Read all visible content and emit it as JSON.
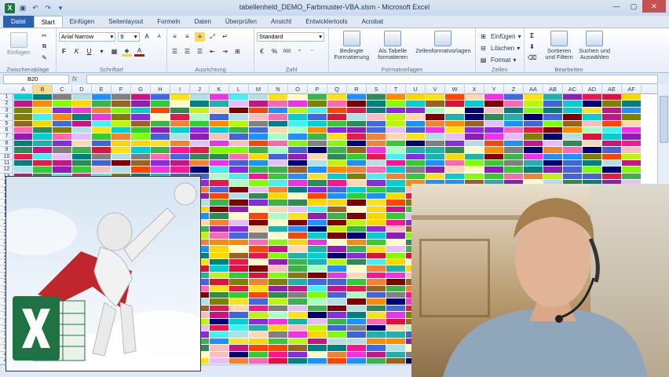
{
  "window": {
    "title": "tabellenheld_DEMO_Farbmuster-VBA.xlsm - Microsoft Excel",
    "app_icon": "excel-logo",
    "controls": [
      "minimize-icon",
      "maximize-icon",
      "close-icon"
    ]
  },
  "tabs": [
    {
      "label": "Datei"
    },
    {
      "label": "Start"
    },
    {
      "label": "Einfügen"
    },
    {
      "label": "Seitenlayout"
    },
    {
      "label": "Formeln"
    },
    {
      "label": "Daten"
    },
    {
      "label": "Überprüfen"
    },
    {
      "label": "Ansicht"
    },
    {
      "label": "Entwicklertools"
    },
    {
      "label": "Acrobat"
    }
  ],
  "ribbon": {
    "clipboard": {
      "paste_label": "Einfügen",
      "group_label": "Zwischenablage"
    },
    "font": {
      "name": "Arial Narrow",
      "size": "9",
      "bold": "F",
      "italic": "K",
      "underline": "U",
      "group_label": "Schriftart"
    },
    "alignment": {
      "group_label": "Ausrichtung"
    },
    "number": {
      "format": "Standard",
      "percent": "%",
      "thousands": "000",
      "group_label": "Zahl"
    },
    "styles": {
      "conditional": "Bedingte Formatierung",
      "as_table": "Als Tabelle formatieren",
      "cell_styles": "Zellenformatvorlagen",
      "group_label": "Formatvorlagen"
    },
    "cells": {
      "insert": "Einfügen",
      "delete": "Löschen",
      "format": "Format",
      "group_label": "Zellen"
    },
    "editing": {
      "sigma": "Σ",
      "sort": "Sortieren und Filtern",
      "find": "Suchen und Auswählen",
      "group_label": "Bearbeiten"
    }
  },
  "formula_bar": {
    "name_box": "B20",
    "fx": "fx",
    "value": ""
  },
  "grid": {
    "columns": [
      "A",
      "B",
      "C",
      "D",
      "E",
      "F",
      "G",
      "H",
      "I",
      "J",
      "K",
      "L",
      "M",
      "N",
      "O",
      "P",
      "Q",
      "R",
      "S",
      "T",
      "U",
      "V",
      "W",
      "X",
      "Y",
      "Z",
      "AA",
      "AB",
      "AC",
      "AD",
      "AE",
      "AF"
    ],
    "rows": [
      "1",
      "2",
      "3",
      "4",
      "5",
      "6",
      "7",
      "8",
      "9",
      "10",
      "11",
      "12"
    ],
    "selected_column": "B"
  },
  "colors": {
    "file_tab": "#2a62b0",
    "ribbon_bg": "#e7eef8",
    "excel_green": "#1f7244"
  }
}
